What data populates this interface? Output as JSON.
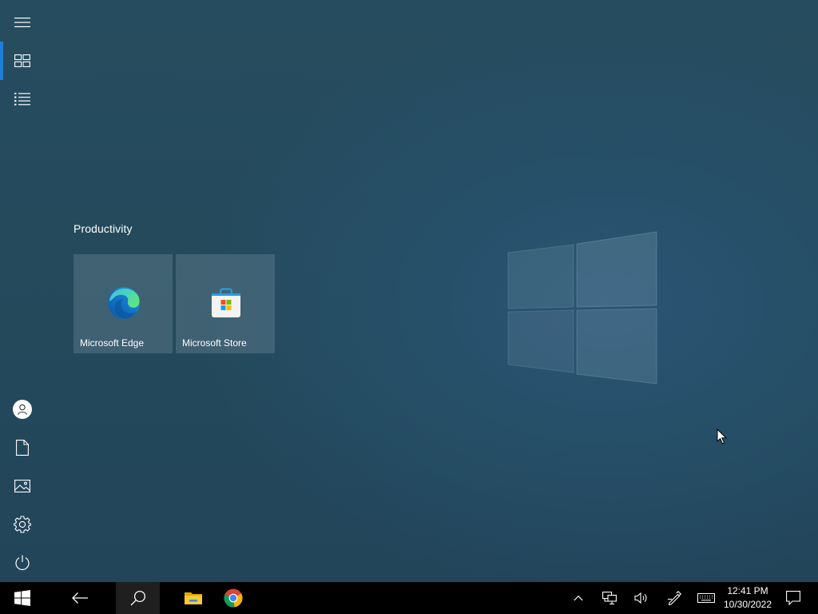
{
  "start_menu": {
    "rail": {
      "top_items": [
        {
          "name": "expand-menu",
          "icon": "hamburger-icon"
        },
        {
          "name": "pinned-tiles",
          "icon": "tiles-icon",
          "active": true
        },
        {
          "name": "all-apps",
          "icon": "list-icon"
        }
      ],
      "bottom_items": [
        {
          "name": "user-account",
          "icon": "user-icon"
        },
        {
          "name": "documents",
          "icon": "document-icon"
        },
        {
          "name": "pictures",
          "icon": "pictures-icon"
        },
        {
          "name": "settings",
          "icon": "gear-icon"
        },
        {
          "name": "power",
          "icon": "power-icon"
        }
      ]
    },
    "group": {
      "title": "Productivity",
      "tiles": [
        {
          "label": "Microsoft Edge",
          "icon": "edge-icon"
        },
        {
          "label": "Microsoft Store",
          "icon": "store-icon"
        }
      ]
    }
  },
  "taskbar": {
    "buttons": [
      {
        "name": "start",
        "icon": "windows-logo-icon"
      },
      {
        "name": "back",
        "icon": "back-arrow-icon"
      },
      {
        "name": "search",
        "icon": "search-icon",
        "active": true
      },
      {
        "name": "file-explorer",
        "icon": "folder-icon"
      },
      {
        "name": "chrome",
        "icon": "chrome-icon"
      }
    ],
    "tray": [
      {
        "name": "show-hidden-icons",
        "icon": "chevron-up-icon"
      },
      {
        "name": "network",
        "icon": "network-icon"
      },
      {
        "name": "volume",
        "icon": "speaker-icon"
      },
      {
        "name": "pen",
        "icon": "pen-icon"
      },
      {
        "name": "touch-keyboard",
        "icon": "keyboard-icon"
      }
    ],
    "clock": {
      "time": "12:41 PM",
      "date": "10/30/2022"
    },
    "notifications_icon": "notification-icon"
  },
  "colors": {
    "accent": "#1e7fd8",
    "taskbar": "#000000",
    "tile": "#5b7c8c"
  }
}
